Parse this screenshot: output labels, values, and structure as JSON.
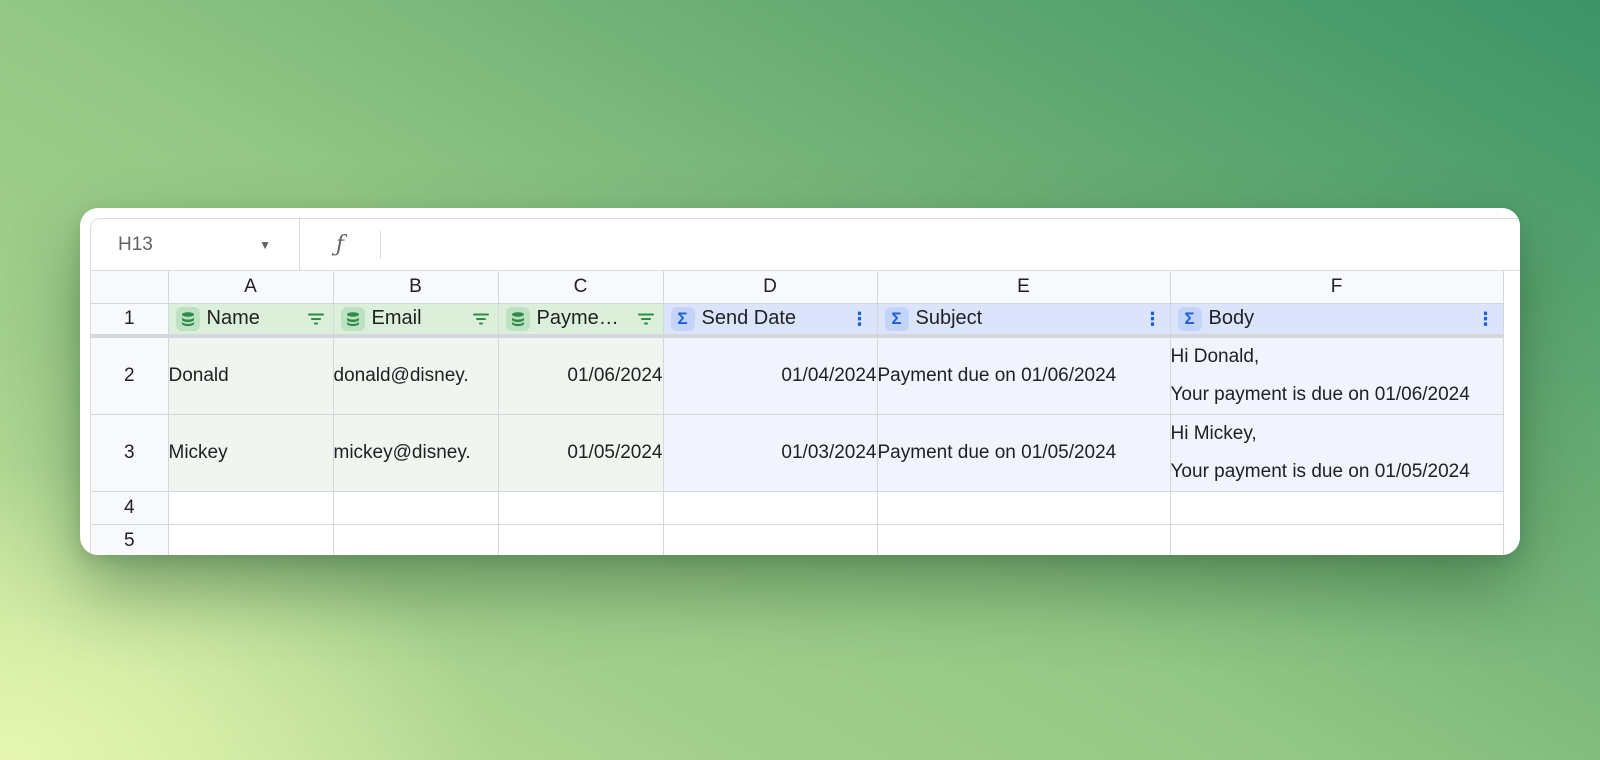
{
  "formula_bar": {
    "cell_ref": "H13",
    "fx_symbol": "ƒ",
    "formula": ""
  },
  "columns": [
    "A",
    "B",
    "C",
    "D",
    "E",
    "F"
  ],
  "row_numbers": [
    "1",
    "2",
    "3",
    "4",
    "5"
  ],
  "headers": [
    {
      "label": "Name",
      "kind": "database",
      "action": "filter"
    },
    {
      "label": "Email",
      "kind": "database",
      "action": "filter"
    },
    {
      "label": "Payme…",
      "kind": "database",
      "action": "filter"
    },
    {
      "label": "Send Date",
      "kind": "formula",
      "action": "more"
    },
    {
      "label": "Subject",
      "kind": "formula",
      "action": "more"
    },
    {
      "label": "Body",
      "kind": "formula",
      "action": "more"
    }
  ],
  "rows": [
    {
      "name": "Donald",
      "email": "donald@disney.",
      "payment": "01/06/2024",
      "send_date": "01/04/2024",
      "subject": "Payment due on 01/06/2024",
      "body_line1": "Hi Donald,",
      "body_line2": "Your payment is due on 01/06/2024"
    },
    {
      "name": "Mickey",
      "email": "mickey@disney.",
      "payment": "01/05/2024",
      "send_date": "01/03/2024",
      "subject": "Payment due on 01/05/2024",
      "body_line1": "Hi Mickey,",
      "body_line2": "Your payment is due on 01/05/2024"
    }
  ],
  "icons": {
    "database": "database-icon",
    "formula": "sigma-icon",
    "filter": "filter-icon",
    "more": "more-vertical-icon",
    "dropdown": "chevron-down-icon"
  },
  "colors": {
    "sourced_header": "#dcefdb",
    "sourced_cell": "#f0f6ef",
    "formula_header": "#dbe4fb",
    "formula_cell": "#f1f4fc",
    "green_icon": "#2e8b4a",
    "blue_icon": "#1a5fd6"
  }
}
